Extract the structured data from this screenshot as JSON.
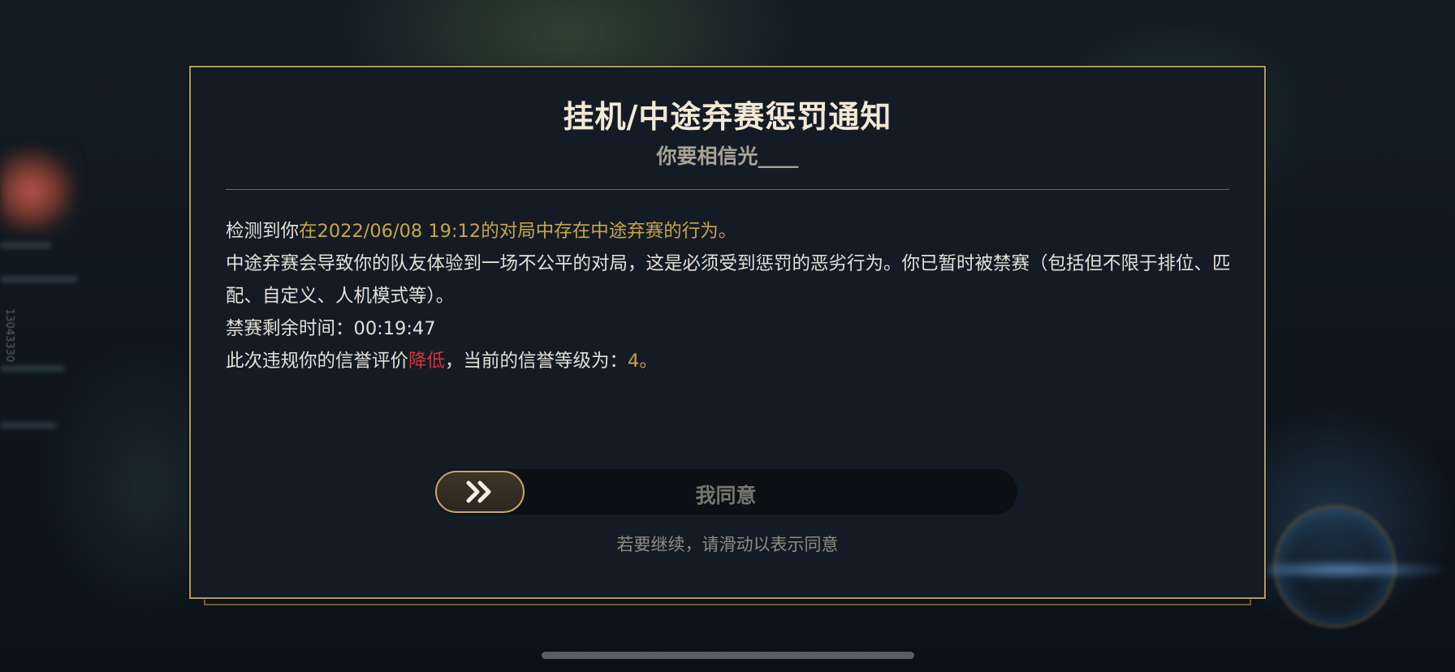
{
  "background": {
    "side_id": "13043330"
  },
  "dialog": {
    "title": "挂机/中途弃赛惩罚通知",
    "subtitle": "你要相信光____",
    "line1_prefix": "检测到你",
    "line1_highlight": "在2022/06/08 19:12的对局中存在中途弃赛的行为。",
    "line2": "中途弃赛会导致你的队友体验到一场不公平的对局，这是必须受到惩罚的恶劣行为。你已暂时被禁赛（包括但不限于排位、匹配、自定义、人机模式等）。",
    "line3": "禁赛剩余时间：00:19:47",
    "line4_prefix": "此次违规你的信誉评价",
    "line4_red": "降低",
    "line4_mid": "，当前的信誉等级为：",
    "line4_level": "4",
    "line4_end": "。",
    "slider_label": "我同意",
    "slider_icon": "double-chevron-right-icon",
    "hint": "若要继续，请滑动以表示同意"
  },
  "colors": {
    "gold": "#c9a548",
    "red": "#d2343a",
    "border": "#b49a5c",
    "panel": "#141b24"
  }
}
